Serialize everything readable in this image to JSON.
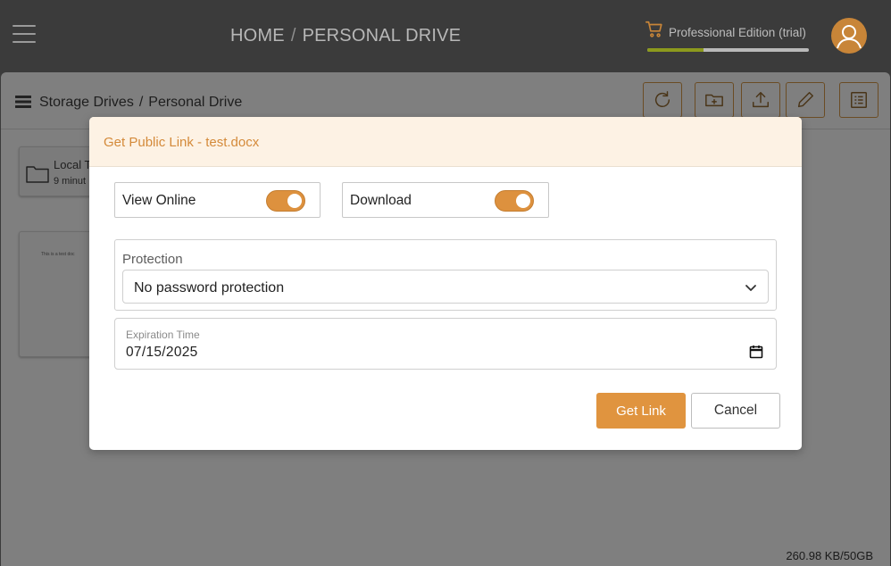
{
  "topbar": {
    "breadcrumb": [
      "HOME",
      "PERSONAL DRIVE"
    ],
    "breadcrumb_separator": "/",
    "edition_label": "Professional Edition (trial)",
    "storage_progress": 0.35,
    "icons": [
      "hamburger-icon",
      "cart-icon",
      "user-icon"
    ]
  },
  "panel": {
    "breadcrumb": [
      "Storage Drives",
      "Personal Drive"
    ],
    "breadcrumb_separator": "/",
    "toolbar_icons": [
      "refresh-icon",
      "new-folder-icon",
      "upload-icon",
      "edit-icon",
      "details-icon"
    ],
    "items": [
      {
        "name": "Local T",
        "time": "9 minut",
        "type": "folder"
      }
    ],
    "file_preview_text": "This is a test doc",
    "usage": "260.98 KB/50GB"
  },
  "modal": {
    "title": "Get Public Link - test.docx",
    "view_online": {
      "label": "View Online",
      "enabled": true
    },
    "download": {
      "label": "Download",
      "enabled": true
    },
    "protection": {
      "label": "Protection",
      "selected": "No password protection"
    },
    "expiration": {
      "label": "Expiration Time",
      "value": "07/15/2025"
    },
    "get_link_label": "Get Link",
    "cancel_label": "Cancel"
  },
  "colors": {
    "accent": "#e0943f",
    "title": "#d48a3a",
    "header_bg": "#fdf2e4",
    "topbar_bg": "#3b3b3b",
    "progress": "#8c9a1d"
  }
}
